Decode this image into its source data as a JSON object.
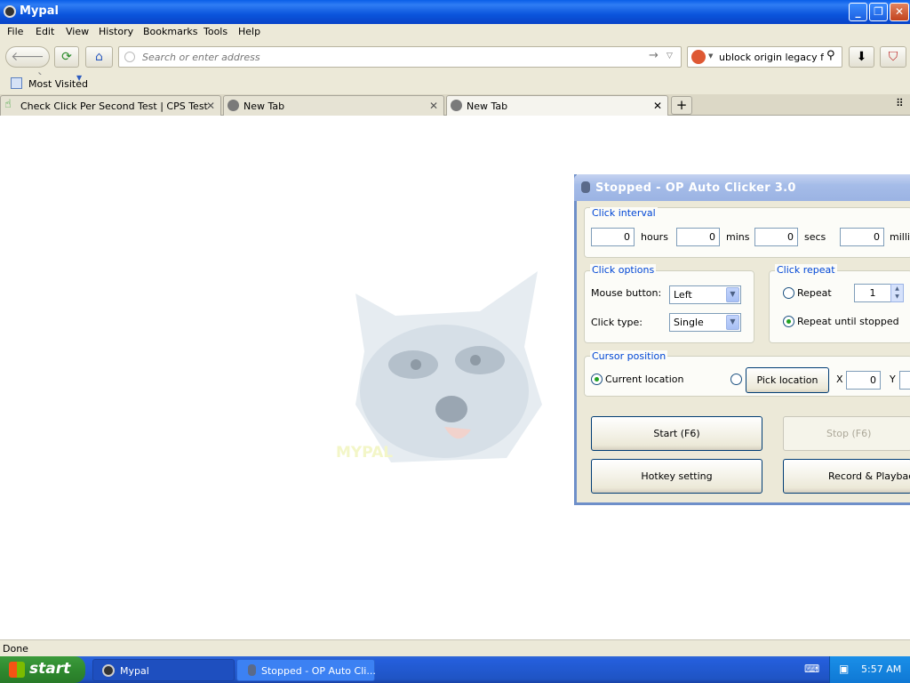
{
  "browser": {
    "title": "Mypal",
    "menu": [
      "File",
      "Edit",
      "View",
      "History",
      "Bookmarks",
      "Tools",
      "Help"
    ],
    "url_placeholder": "Search or enter address",
    "search_value": "ublock origin legacy firef",
    "bookmarks": {
      "most_visited": "Most Visited"
    },
    "tabs": [
      {
        "label": "Check Click Per Second Test | CPS Test",
        "active": false
      },
      {
        "label": "New Tab",
        "active": false
      },
      {
        "label": "New Tab",
        "active": true
      }
    ],
    "status": "Done",
    "page_watermark_text": "MYPAL"
  },
  "taskbar": {
    "start": "start",
    "tasks": [
      {
        "label": "Mypal"
      },
      {
        "label": "Stopped - OP Auto Cli..."
      }
    ],
    "clock": "5:57 AM"
  },
  "autoclicker": {
    "title": "Stopped - OP Auto Clicker 3.0",
    "interval": {
      "label": "Click interval",
      "hours": "0",
      "hours_label": "hours",
      "mins": "0",
      "mins_label": "mins",
      "secs": "0",
      "secs_label": "secs",
      "millis": "0",
      "millis_label": "millise"
    },
    "options": {
      "label": "Click options",
      "mouse_button_label": "Mouse button:",
      "mouse_button_value": "Left",
      "click_type_label": "Click type:",
      "click_type_value": "Single"
    },
    "repeat": {
      "label": "Click repeat",
      "repeat_label": "Repeat",
      "repeat_count": "1",
      "until_stopped_label": "Repeat until stopped",
      "selected": "until_stopped"
    },
    "cursor": {
      "label": "Cursor position",
      "current_label": "Current location",
      "pick_button": "Pick location",
      "x_label": "X",
      "x_value": "0",
      "y_label": "Y",
      "selected": "current"
    },
    "buttons": {
      "start": "Start (F6)",
      "stop": "Stop (F6)",
      "hotkey": "Hotkey setting",
      "record": "Record & Playback"
    }
  }
}
